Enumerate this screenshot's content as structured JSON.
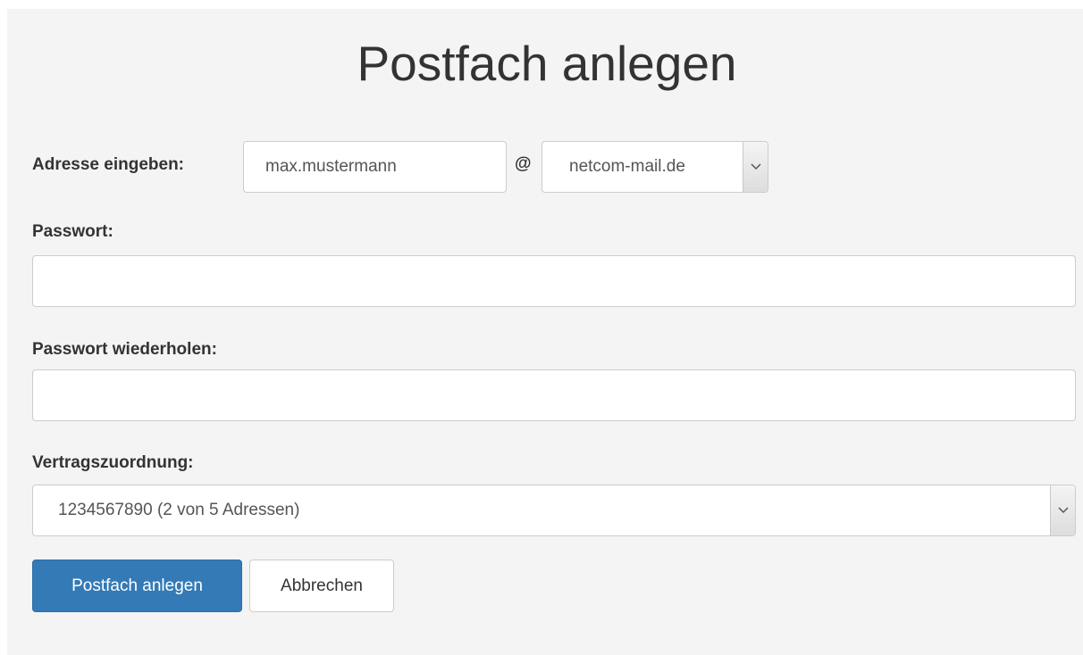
{
  "page": {
    "title": "Postfach anlegen"
  },
  "address": {
    "label": "Adresse eingeben:",
    "local_part_value": "max.mustermann",
    "at_symbol": "@",
    "domain_selected": "netcom-mail.de"
  },
  "password": {
    "label": "Passwort:",
    "value": ""
  },
  "password_repeat": {
    "label": "Passwort wiederholen:",
    "value": ""
  },
  "contract": {
    "label": "Vertragszuordnung:",
    "selected": "1234567890 (2 von 5 Adressen)"
  },
  "actions": {
    "submit_label": "Postfach anlegen",
    "cancel_label": "Abbrechen"
  },
  "icons": {
    "select_arrow": "chevron-down-icon"
  },
  "colors": {
    "primary_button": "#337ab7",
    "panel_background": "#f4f4f4"
  }
}
